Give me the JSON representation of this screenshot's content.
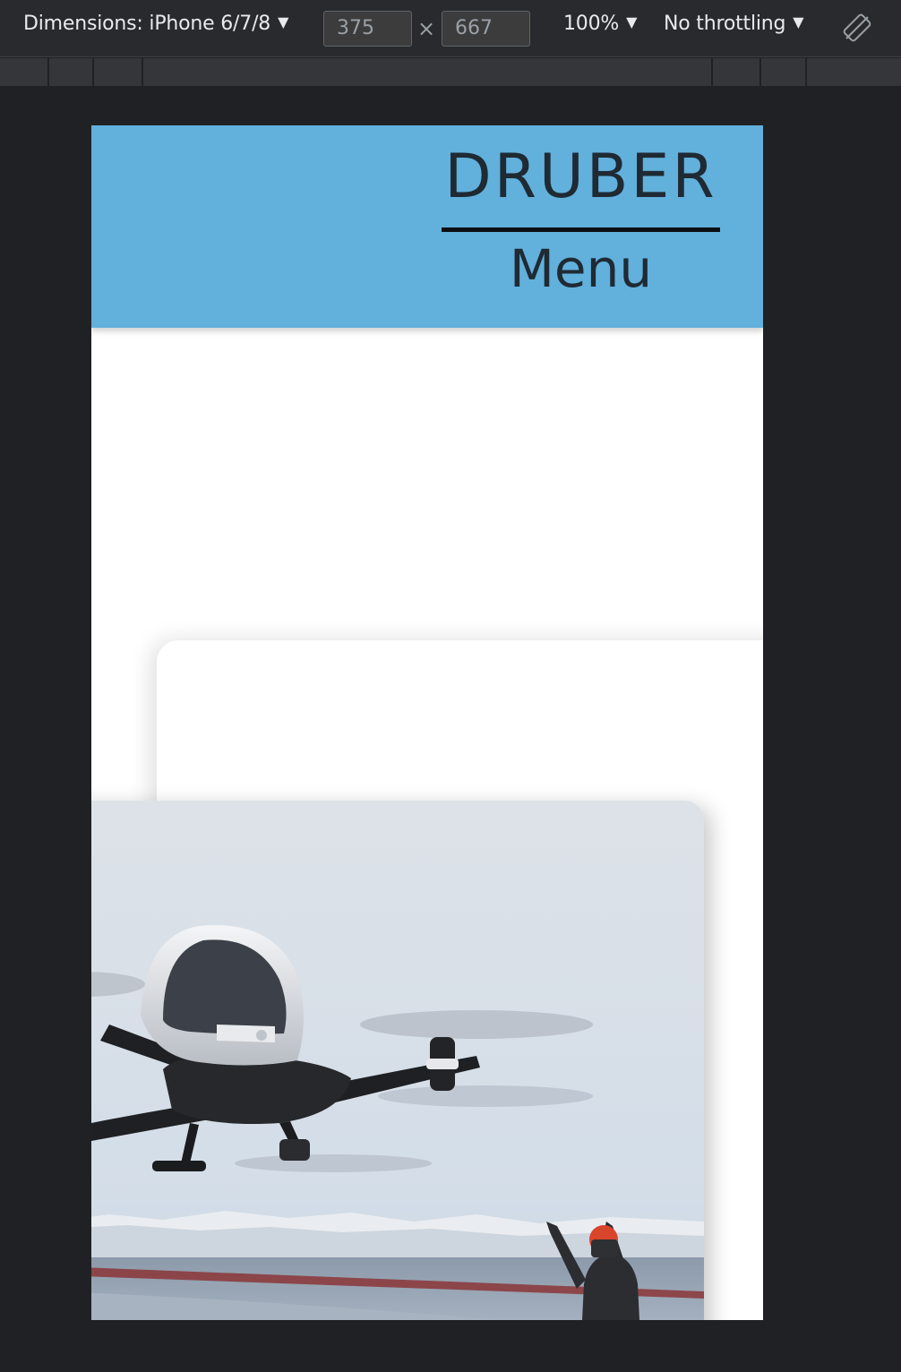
{
  "devtools": {
    "device_label": "Dimensions: iPhone 6/7/8",
    "width_value": "375",
    "height_value": "667",
    "times_symbol": "×",
    "zoom": "100%",
    "throttling": "No throttling",
    "caret": "▼",
    "rotate_icon": "rotate-icon"
  },
  "site": {
    "brand": "DRUBER",
    "menu_label": "Menu",
    "header_color": "#62b0dc",
    "hero_image": "passenger-drone-photo"
  }
}
